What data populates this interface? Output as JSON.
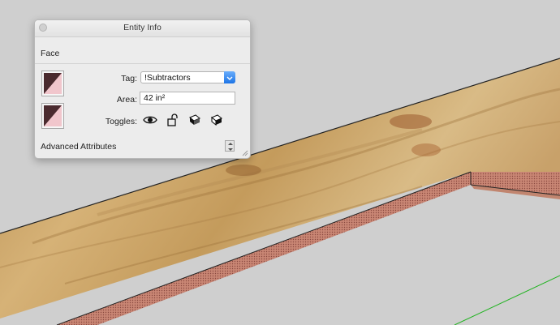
{
  "panel": {
    "title": "Entity Info",
    "entity_type": "Face",
    "tag_label": "Tag:",
    "tag_value": "!Subtractors",
    "area_label": "Area:",
    "area_value": "42 in²",
    "toggles_label": "Toggles:",
    "toggle_icons": [
      "eye-icon",
      "lock-icon",
      "cast-shadows-icon",
      "receive-shadows-icon"
    ],
    "advanced_label": "Advanced Attributes"
  },
  "colors": {
    "viewport_background": "#cfcfcf",
    "plywood": "#c59a5a",
    "edge_face": "#c68472",
    "axis_green": "#21b321",
    "swatch_fill": "#f1c6cc",
    "swatch_back": "#4a2a2e",
    "select_accent": "#1d74e6"
  }
}
